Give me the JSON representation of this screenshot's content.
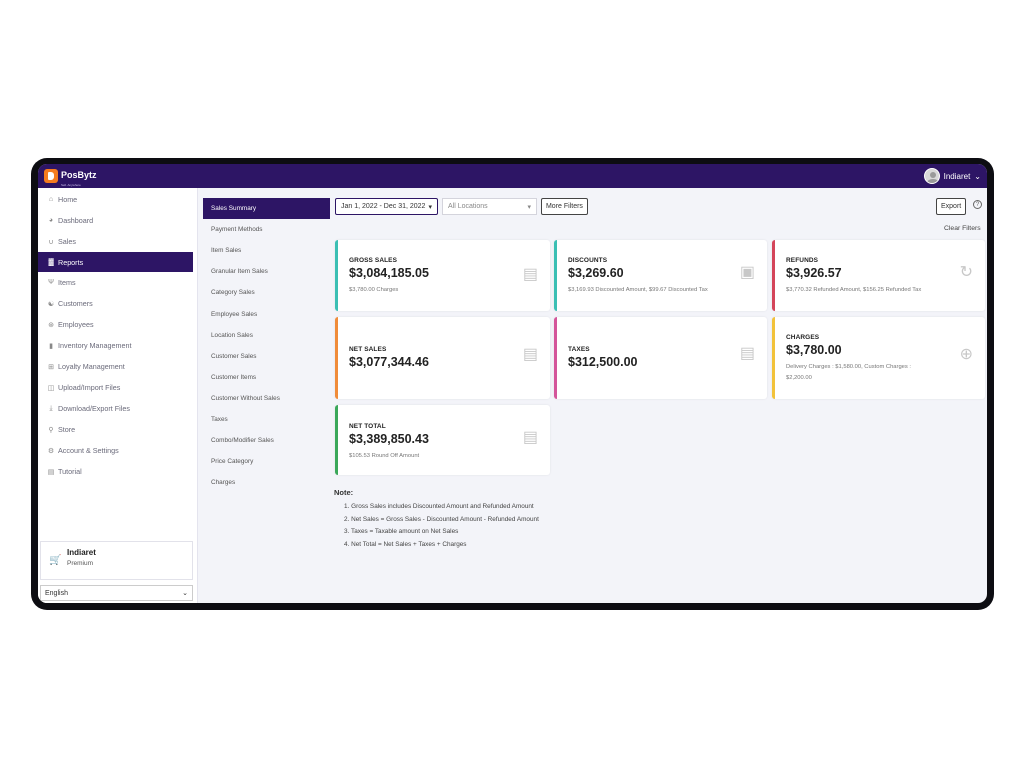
{
  "app": {
    "name": "PosBytz",
    "tagline": "Sell. Anywhere"
  },
  "user": {
    "name": "Indiaret"
  },
  "sidebar": {
    "items": [
      {
        "label": "Home",
        "icon": "home-icon"
      },
      {
        "label": "Dashboard",
        "icon": "dashboard-icon"
      },
      {
        "label": "Sales",
        "icon": "sales-icon"
      },
      {
        "label": "Reports",
        "icon": "reports-icon",
        "active": true
      },
      {
        "label": "Items",
        "icon": "items-icon"
      },
      {
        "label": "Customers",
        "icon": "customers-icon"
      },
      {
        "label": "Employees",
        "icon": "employees-icon"
      },
      {
        "label": "Inventory Management",
        "icon": "inventory-icon"
      },
      {
        "label": "Loyalty Management",
        "icon": "loyalty-icon"
      },
      {
        "label": "Upload/Import Files",
        "icon": "upload-icon"
      },
      {
        "label": "Download/Export Files",
        "icon": "download-icon"
      },
      {
        "label": "Store",
        "icon": "store-icon"
      },
      {
        "label": "Account & Settings",
        "icon": "settings-icon"
      },
      {
        "label": "Tutorial",
        "icon": "tutorial-icon"
      }
    ],
    "plan": {
      "name": "Indiaret",
      "tier": "Premium"
    },
    "language": "English"
  },
  "report_nav": {
    "items": [
      {
        "label": "Sales Summary",
        "active": true
      },
      {
        "label": "Payment Methods"
      },
      {
        "label": "Item Sales"
      },
      {
        "label": "Granular Item Sales"
      },
      {
        "label": "Category Sales"
      },
      {
        "label": "Employee Sales"
      },
      {
        "label": "Location Sales"
      },
      {
        "label": "Customer Sales"
      },
      {
        "label": "Customer Items"
      },
      {
        "label": "Customer Without Sales"
      },
      {
        "label": "Taxes"
      },
      {
        "label": "Combo/Modifier Sales"
      },
      {
        "label": "Price Category"
      },
      {
        "label": "Charges"
      }
    ]
  },
  "filters": {
    "date_range": "Jan 1, 2022 - Dec 31, 2022",
    "location": "All Locations",
    "more_filters": "More Filters",
    "export": "Export",
    "clear_filters": "Clear Filters"
  },
  "cards": {
    "gross_sales": {
      "label": "GROSS SALES",
      "value": "$3,084,185.05",
      "sub": "$3,780.00 Charges",
      "color": "#3bbfb4"
    },
    "discounts": {
      "label": "DISCOUNTS",
      "value": "$3,269.60",
      "sub": "$3,169.93 Discounted Amount, $99.67 Discounted Tax",
      "color": "#3bbfb4"
    },
    "refunds": {
      "label": "REFUNDS",
      "value": "$3,926.57",
      "sub": "$3,770.32 Refunded Amount, $156.25 Refunded Tax",
      "color": "#d4455a"
    },
    "net_sales": {
      "label": "NET SALES",
      "value": "$3,077,344.46",
      "sub": "",
      "color": "#f08c3a"
    },
    "taxes": {
      "label": "TAXES",
      "value": "$312,500.00",
      "sub": "",
      "color": "#d4559a"
    },
    "charges": {
      "label": "CHARGES",
      "value": "$3,780.00",
      "sub": "Delivery Charges : $1,580.00, Custom Charges : $2,200.00",
      "color": "#f2c23a"
    },
    "net_total": {
      "label": "NET TOTAL",
      "value": "$3,389,850.43",
      "sub": "$105.53 Round Off Amount",
      "color": "#3ba85a"
    }
  },
  "note": {
    "title": "Note:",
    "items": [
      "Gross Sales includes Discounted Amount and Refunded Amount",
      "Net Sales = Gross Sales - Discounted Amount - Refunded Amount",
      "Taxes = Taxable amount on Net Sales",
      "Net Total = Net Sales + Taxes + Charges"
    ]
  }
}
